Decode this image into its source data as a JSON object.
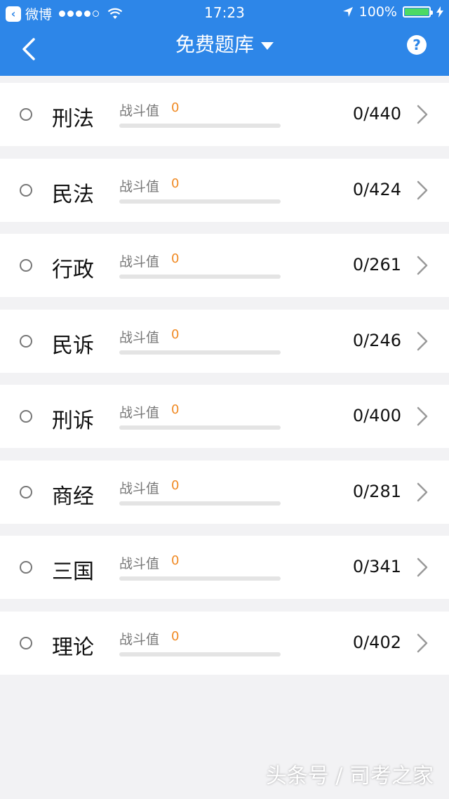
{
  "status_bar": {
    "back_app": "微博",
    "time": "17:23",
    "battery": "100%"
  },
  "nav": {
    "title": "免费题库",
    "help_icon": "?"
  },
  "rows": [
    {
      "subject": "刑法",
      "score_label": "战斗值",
      "score": "0",
      "count": "0/440",
      "progress": 0
    },
    {
      "subject": "民法",
      "score_label": "战斗值",
      "score": "0",
      "count": "0/424",
      "progress": 0
    },
    {
      "subject": "行政",
      "score_label": "战斗值",
      "score": "0",
      "count": "0/261",
      "progress": 0
    },
    {
      "subject": "民诉",
      "score_label": "战斗值",
      "score": "0",
      "count": "0/246",
      "progress": 0
    },
    {
      "subject": "刑诉",
      "score_label": "战斗值",
      "score": "0",
      "count": "0/400",
      "progress": 0
    },
    {
      "subject": "商经",
      "score_label": "战斗值",
      "score": "0",
      "count": "0/281",
      "progress": 0
    },
    {
      "subject": "三国",
      "score_label": "战斗值",
      "score": "0",
      "count": "0/341",
      "progress": 0
    },
    {
      "subject": "理论",
      "score_label": "战斗值",
      "score": "0",
      "count": "0/402",
      "progress": 0
    }
  ],
  "watermark": "头条号 / 司考之家",
  "colors": {
    "header": "#2d86e8",
    "accent_orange": "#f08a24",
    "background": "#f2f2f4"
  }
}
